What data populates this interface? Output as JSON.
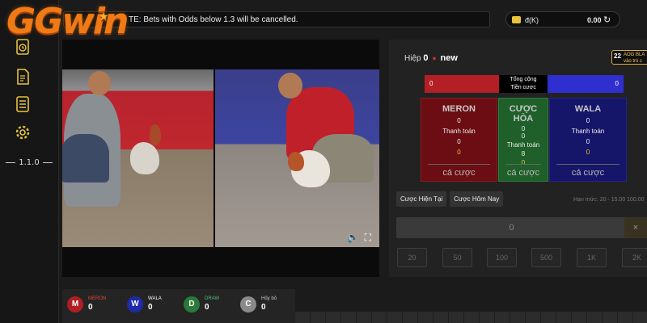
{
  "brand": {
    "logo_text": "GGwin"
  },
  "sidebar": {
    "icons": [
      "history-icon",
      "document-icon",
      "list-icon",
      "gear-icon"
    ],
    "version": "1.1.0"
  },
  "topbar": {
    "notice": "TE: Bets with Odds below 1.3 will be cancelled.",
    "balance": {
      "currency": "đ(K)",
      "amount": "0.00"
    }
  },
  "round": {
    "label": "Hiệp",
    "number": "0",
    "status": "new"
  },
  "aog_badge": {
    "number": "22",
    "line1": "AOG BLA",
    "line2": "vào trò c"
  },
  "totals": {
    "left": "0",
    "center_line1": "Tổng cộng",
    "center_line2": "Tiền cược",
    "right": "0"
  },
  "bet_cards": [
    {
      "title": "MERON",
      "values": [
        "0",
        "Thanh toán",
        "0",
        "0"
      ],
      "button": "cá cược",
      "color": "#6b0d12"
    },
    {
      "title": "CƯỢC HÒA",
      "values": [
        "0",
        "0",
        "Thanh toán",
        "8",
        "0"
      ],
      "button": "cá cược",
      "color": "#1f5f2a"
    },
    {
      "title": "WALA",
      "values": [
        "0",
        "Thanh toán",
        "0",
        "0"
      ],
      "button": "cá cược",
      "color": "#15156a"
    }
  ],
  "tabs": [
    "Cược Hiện Tại",
    "Cược Hôm Nay"
  ],
  "limits": "Hạn mức: 20 - 15.00 100.00",
  "amount": {
    "value": "0",
    "clear": "×"
  },
  "chips": [
    "20",
    "50",
    "100",
    "500",
    "1K",
    "2K"
  ],
  "results": [
    {
      "letter": "M",
      "name": "MERON",
      "count": "0",
      "color": "#b01e23",
      "name_color": "#e0452e"
    },
    {
      "letter": "W",
      "name": "WALA",
      "count": "0",
      "color": "#1e2aa8",
      "name_color": "#ffffff"
    },
    {
      "letter": "D",
      "name": "DRAW",
      "count": "0",
      "color": "#2a7a3a",
      "name_color": "#4cc07a"
    },
    {
      "letter": "C",
      "name": "Hủy bỏ",
      "count": "0",
      "color": "#8a8a8a",
      "name_color": "#cccccc"
    }
  ]
}
